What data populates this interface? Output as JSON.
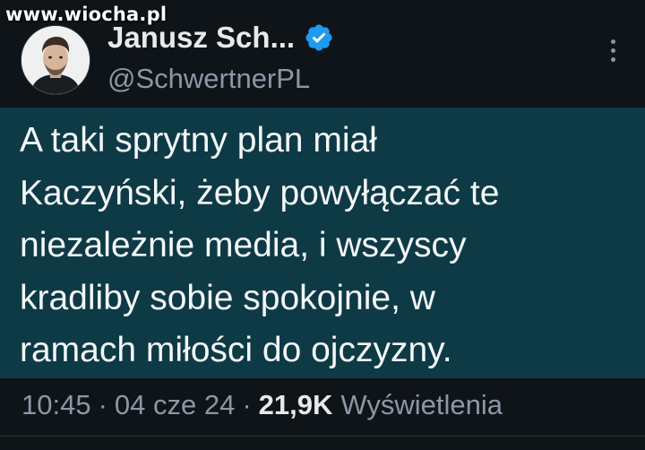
{
  "watermark": "www.wiocha.pl",
  "author": {
    "display_name": "Janusz Sch...",
    "handle": "@SchwertnerPL",
    "verified_icon": "verified-badge-icon",
    "avatar_icon": "avatar"
  },
  "tweet": {
    "lines": [
      "A taki sprytny plan miał",
      "Kaczyński, żeby powyłączać te",
      "niezależnie media, i wszyscy",
      "kradliby sobie spokojnie, w",
      "ramach miłości do ojczyzny."
    ]
  },
  "meta": {
    "time": "10:45",
    "separator": "·",
    "date": "04 cze 24",
    "views_count": "21,9K",
    "views_label": "Wyświetlenia"
  },
  "colors": {
    "background": "#0f1419",
    "tweet_highlight": "#0e3a46",
    "verified": "#1d9bf0",
    "secondary_text": "#8b98a5",
    "primary_text": "#e7e9ea"
  },
  "icons": {
    "more": "more-options-icon"
  }
}
